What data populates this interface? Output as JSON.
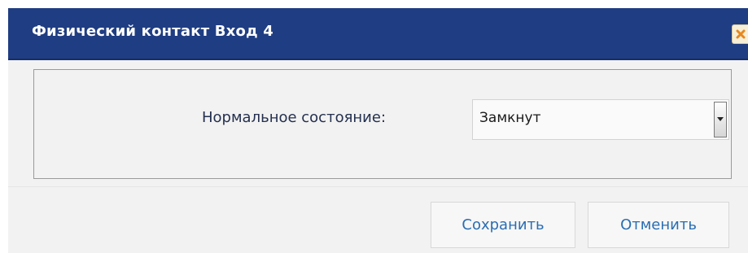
{
  "dialog": {
    "title": "Физический контакт Вход 4",
    "close_icon": "close-icon",
    "accent_color": "#1f3d82"
  },
  "form": {
    "normal_state_label": "Нормальное состояние:",
    "normal_state_value": "Замкнут"
  },
  "actions": {
    "save_label": "Сохранить",
    "cancel_label": "Отменить"
  }
}
